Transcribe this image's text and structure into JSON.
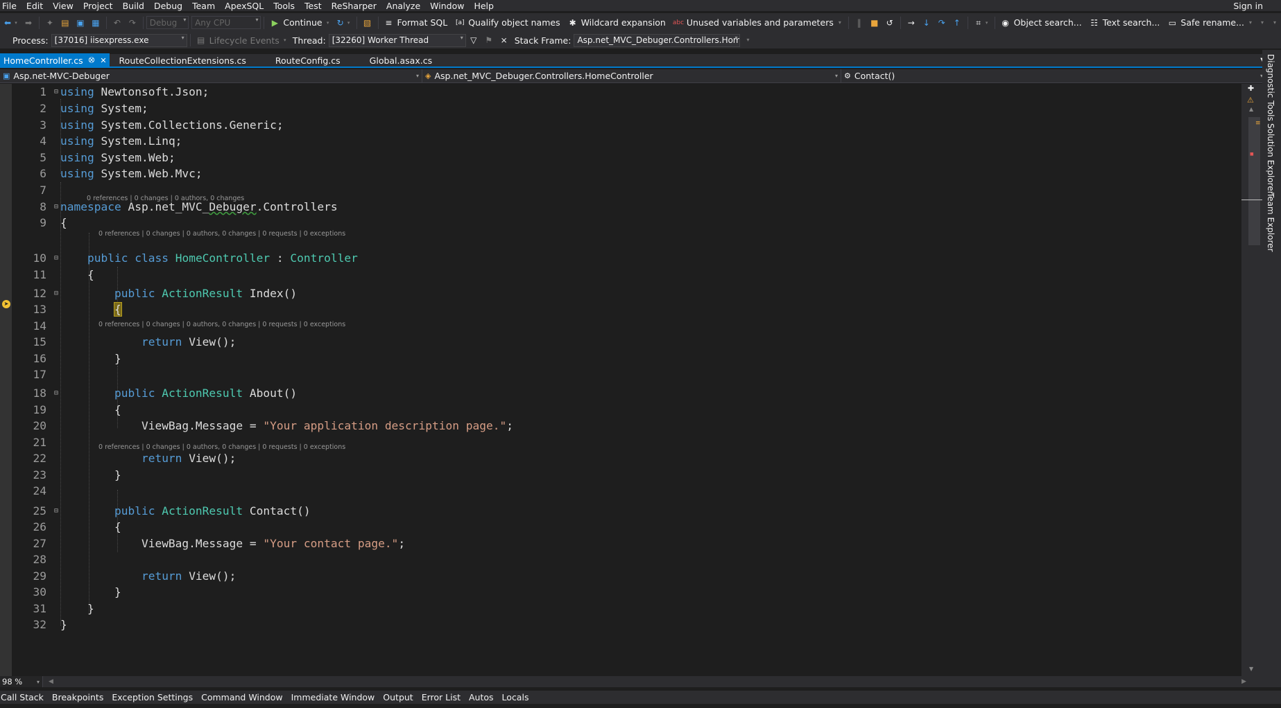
{
  "menu": [
    "File",
    "Edit",
    "View",
    "Project",
    "Build",
    "Debug",
    "Team",
    "ApexSQL",
    "Tools",
    "Test",
    "ReSharper",
    "Analyze",
    "Window",
    "Help"
  ],
  "account": {
    "sign_in": "Sign in"
  },
  "toolbar": {
    "config": "Debug",
    "platform": "Any CPU",
    "continue": "Continue",
    "format_sql": "Format SQL",
    "qualify": "Qualify object names",
    "wildcard": "Wildcard expansion",
    "unused": "Unused variables and parameters",
    "object_search": "Object search...",
    "text_search": "Text search...",
    "safe_rename": "Safe rename..."
  },
  "debug_bar": {
    "process_label": "Process:",
    "process": "[37016] iisexpress.exe",
    "lifecycle": "Lifecycle Events",
    "thread_label": "Thread:",
    "thread": "[32260] Worker Thread",
    "stack_label": "Stack Frame:",
    "stack": "Asp.net_MVC_Debuger.Controllers.Home("
  },
  "tabs": [
    {
      "label": "HomeController.cs"
    },
    {
      "label": "RouteCollectionExtensions.cs"
    },
    {
      "label": "RouteConfig.cs"
    },
    {
      "label": "Global.asax.cs"
    }
  ],
  "nav": {
    "project": "Asp.net-MVC-Debuger",
    "type": "Asp.net_MVC_Debuger.Controllers.HomeController",
    "member": "Contact()"
  },
  "code": {
    "lines": [
      "1",
      "2",
      "3",
      "4",
      "5",
      "6",
      "7",
      "8",
      "9",
      "10",
      "11",
      "12",
      "13",
      "14",
      "15",
      "16",
      "17",
      "18",
      "19",
      "20",
      "21",
      "22",
      "23",
      "24",
      "25",
      "26",
      "27",
      "28",
      "29",
      "30",
      "31",
      "32"
    ],
    "using_kw": "using",
    "usings": [
      "Newtonsoft.Json;",
      "System;",
      "System.Collections.Generic;",
      "System.Linq;",
      "System.Web;",
      "System.Web.Mvc;"
    ],
    "namespace_kw": "namespace",
    "ns_a": "Asp.net_MVC_",
    "ns_b": "Debuger",
    "ns_c": ".Controllers",
    "open_brace": "{",
    "close_brace": "}",
    "public_kw": "public",
    "class_kw": "class",
    "class_name": "HomeController",
    "colon": " : ",
    "base_class": "Controller",
    "action_result": "ActionResult",
    "m_index": "Index()",
    "m_about": "About()",
    "m_contact": "Contact()",
    "return_kw": "return",
    "view_call": "View();",
    "viewbag_msg": "ViewBag.Message",
    "assign": " = ",
    "about_str": "\"Your application description page.\"",
    "contact_str": "\"Your contact page.\"",
    "semicolon": ";",
    "lens_class": "0 references | 0 changes | 0 authors, 0 changes",
    "lens_method": "0 references | 0 changes | 0 authors, 0 changes | 0 requests | 0 exceptions"
  },
  "status": {
    "zoom": "98 %"
  },
  "bottom_tabs": [
    "Call Stack",
    "Breakpoints",
    "Exception Settings",
    "Command Window",
    "Immediate Window",
    "Output",
    "Error List",
    "Autos",
    "Locals"
  ],
  "side_tabs": [
    "Diagnostic Tools",
    "Solution Explorer",
    "Team Explorer"
  ],
  "colors": {
    "accent": "#007acc",
    "keyword": "#569cd6",
    "type": "#4ec9b0",
    "string": "#d69d85",
    "background": "#1e1e1e"
  }
}
